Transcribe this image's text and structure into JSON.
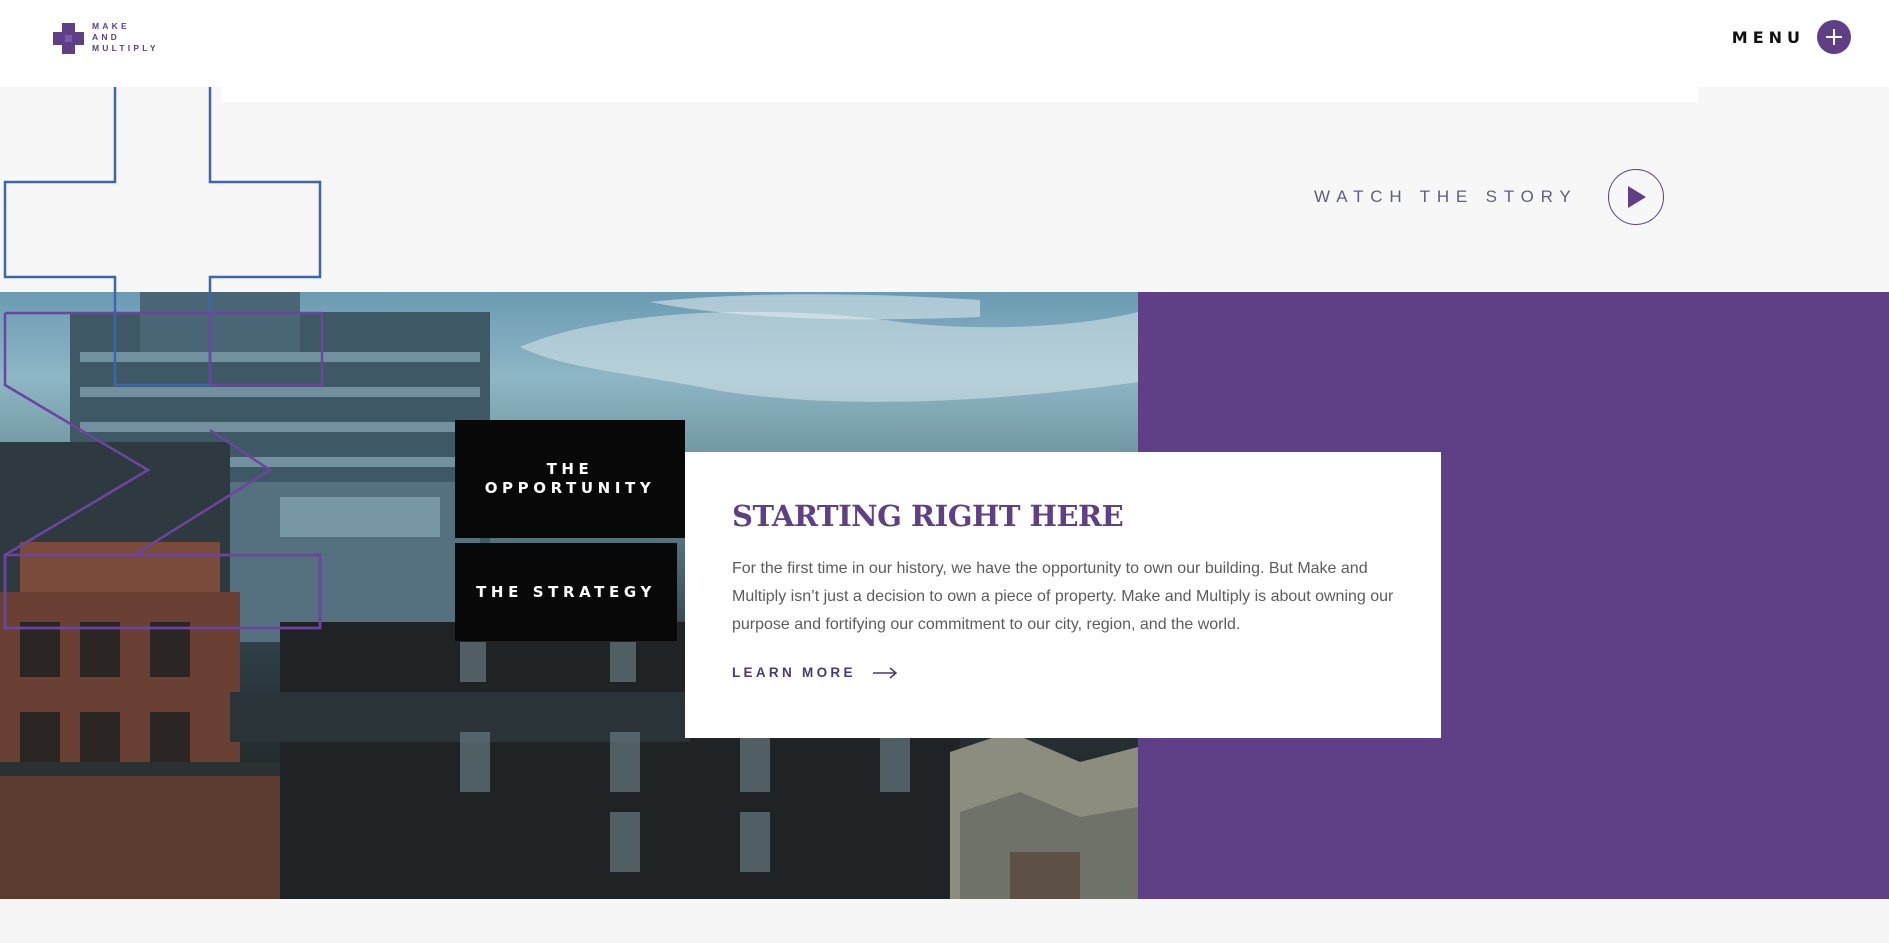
{
  "header": {
    "logo_lines": [
      "MAKE",
      "AND",
      "MULTIPLY"
    ],
    "menu_label": "MENU",
    "menu_icon": "plus-icon"
  },
  "hero": {
    "watch_label": "WATCH THE STORY",
    "play_icon": "play-icon"
  },
  "tabs": [
    {
      "label": "THE OPPORTUNITY",
      "lines": [
        "THE",
        "OPPORTUNITY"
      ]
    },
    {
      "label": "THE STRATEGY"
    }
  ],
  "card": {
    "title": "STARTING RIGHT HERE",
    "body": "For the first time in our history, we have the opportunity to own our building. But Make and Multiply isn’t just a decision to own a piece of property. Make and Multiply is about owning our purpose and fortifying our commitment to our city, region, and the world.",
    "link_label": "LEARN MORE",
    "link_icon": "arrow-right-icon"
  },
  "colors": {
    "brand_purple": "#5f3f86",
    "outline_blue": "#3e66b0",
    "outline_purple": "#6c45a0",
    "tab_black": "#080808"
  }
}
